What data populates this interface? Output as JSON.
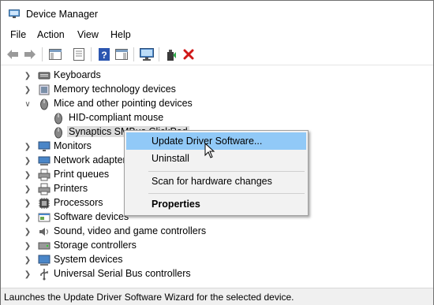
{
  "window": {
    "title": "Device Manager"
  },
  "menu": [
    "File",
    "Action",
    "View",
    "Help"
  ],
  "toolbar": {
    "buttons": [
      "back-icon",
      "forward-icon",
      "show-hide-console-tree-icon",
      "properties-icon",
      "help-icon",
      "action-pane-icon",
      "monitor-icon",
      "update-driver-icon",
      "uninstall-icon"
    ]
  },
  "tree": {
    "items": [
      {
        "label": "Keyboards",
        "expander": "collapsed",
        "icon": "keyboard-icon"
      },
      {
        "label": "Memory technology devices",
        "expander": "collapsed",
        "icon": "memory-icon"
      },
      {
        "label": "Mice and other pointing devices",
        "expander": "expanded",
        "icon": "mouse-icon"
      },
      {
        "label": "HID-compliant mouse",
        "expander": "none",
        "icon": "mouse-icon"
      },
      {
        "label": "Synaptics SMBus ClickPad",
        "expander": "none",
        "icon": "mouse-icon"
      },
      {
        "label": "Monitors",
        "expander": "collapsed",
        "icon": "monitor-icon"
      },
      {
        "label": "Network adapters",
        "expander": "collapsed",
        "icon": "network-adapter-icon"
      },
      {
        "label": "Print queues",
        "expander": "collapsed",
        "icon": "printer-icon"
      },
      {
        "label": "Printers",
        "expander": "collapsed",
        "icon": "printer-icon"
      },
      {
        "label": "Processors",
        "expander": "collapsed",
        "icon": "processor-icon"
      },
      {
        "label": "Software devices",
        "expander": "collapsed",
        "icon": "software-device-icon"
      },
      {
        "label": "Sound, video and game controllers",
        "expander": "collapsed",
        "icon": "speaker-icon"
      },
      {
        "label": "Storage controllers",
        "expander": "collapsed",
        "icon": "storage-icon"
      },
      {
        "label": "System devices",
        "expander": "collapsed",
        "icon": "system-device-icon"
      },
      {
        "label": "Universal Serial Bus controllers",
        "expander": "collapsed",
        "icon": "usb-icon"
      }
    ]
  },
  "context_menu": {
    "update": "Update Driver Software...",
    "uninstall": "Uninstall",
    "scan": "Scan for hardware changes",
    "properties": "Properties"
  },
  "status": "Launches the Update Driver Software Wizard for the selected device.",
  "colors": {
    "highlight": "#91c9f7",
    "selection": "#dcdcdc",
    "delete": "#d01818"
  }
}
